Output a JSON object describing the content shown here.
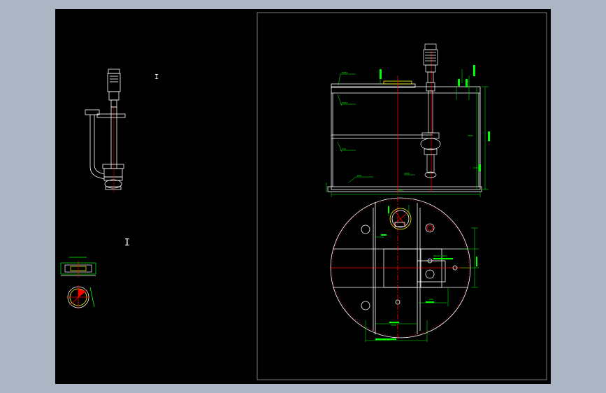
{
  "window": {
    "background_color": "#abb5c4",
    "canvas_color": "#000000"
  },
  "colors": {
    "outline": "#ffffff",
    "dimension": "#00ff00",
    "centerline": "#ff0000",
    "highlight": "#ffff00",
    "frame": "#b0b0b0"
  },
  "cursor": {
    "marker_1": "I",
    "marker_2": "I"
  },
  "dimensions": {
    "tank_width": "Φ3300",
    "tank_height": "3000",
    "bottom_label": "3000",
    "plan_width": "Φ3300 Φ3300",
    "nozzle_a": "DN50",
    "nozzle_b": "DN50",
    "small_a": "300",
    "small_b": "600",
    "top_label": "2000",
    "side_label_a": "1600",
    "side_label_b": "1600",
    "side_label_c": "800",
    "plan_top": "1500",
    "plan_bottom": "1500",
    "plan_right": "DN100 DN50",
    "small_c": "200"
  }
}
